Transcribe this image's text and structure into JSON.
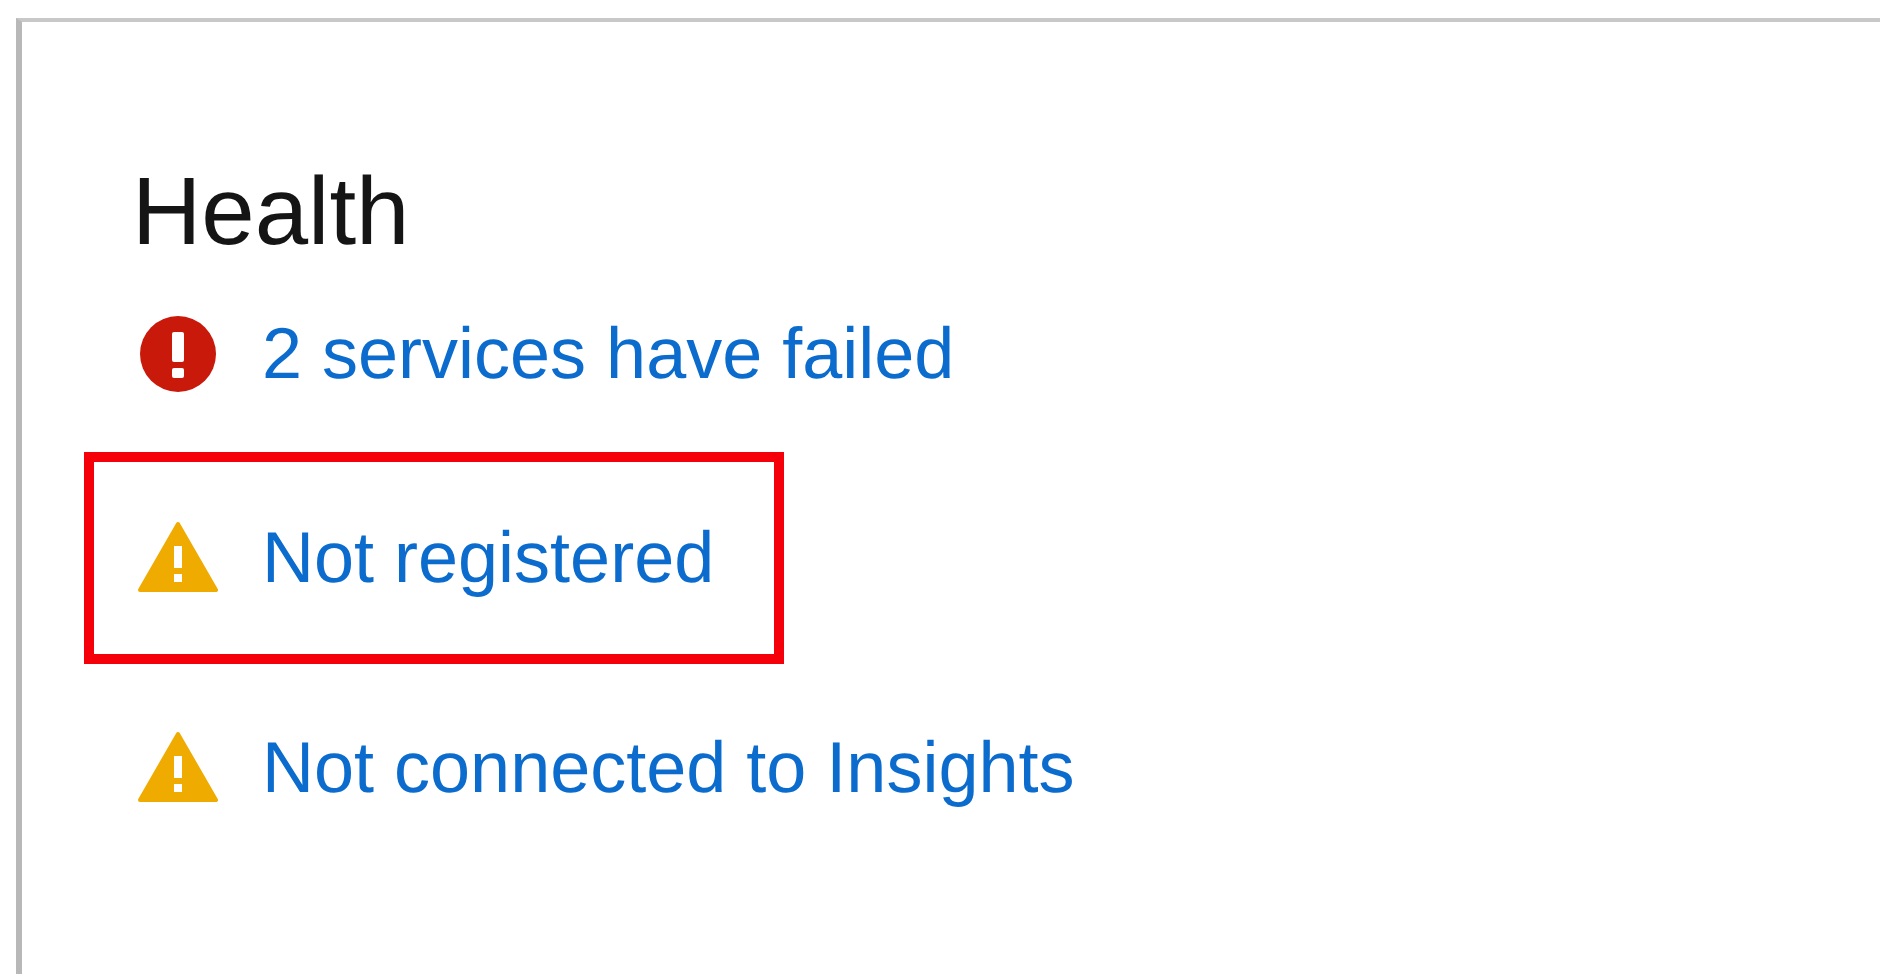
{
  "card": {
    "title": "Health",
    "items": [
      {
        "kind": "error",
        "label": "2 services have failed",
        "highlighted": false
      },
      {
        "kind": "warning",
        "label": "Not registered",
        "highlighted": true
      },
      {
        "kind": "warning",
        "label": "Not connected to Insights",
        "highlighted": false
      }
    ]
  }
}
